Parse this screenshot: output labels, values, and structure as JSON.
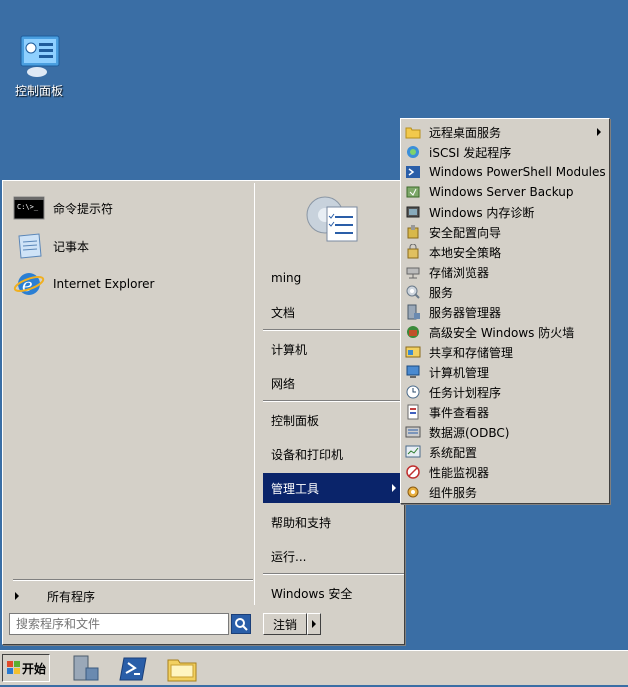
{
  "desktop": {
    "icon_label": "控制面板"
  },
  "start_menu": {
    "programs": [
      {
        "label": "命令提示符",
        "icon": "cmd-icon"
      },
      {
        "label": "记事本",
        "icon": "notepad-icon"
      },
      {
        "label": "Internet Explorer",
        "icon": "ie-icon"
      }
    ],
    "all_programs": "所有程序",
    "search_placeholder": "搜索程序和文件",
    "right": {
      "user": "ming",
      "documents": "文档",
      "computer": "计算机",
      "network": "网络",
      "control_panel": "控制面板",
      "devices": "设备和打印机",
      "admin_tools": "管理工具",
      "help": "帮助和支持",
      "run": "运行...",
      "windows_security": "Windows 安全"
    },
    "logoff": "注销"
  },
  "submenu": {
    "items": [
      {
        "label": "远程桌面服务",
        "icon": "folder-icon",
        "has_submenu": true
      },
      {
        "label": "iSCSI 发起程序",
        "icon": "iscsi-icon"
      },
      {
        "label": "Windows PowerShell Modules",
        "icon": "powershell-icon"
      },
      {
        "label": "Windows Server Backup",
        "icon": "backup-icon"
      },
      {
        "label": "Windows 内存诊断",
        "icon": "memory-diagnostic-icon"
      },
      {
        "label": "安全配置向导",
        "icon": "security-wizard-icon"
      },
      {
        "label": "本地安全策略",
        "icon": "security-policy-icon"
      },
      {
        "label": "存储浏览器",
        "icon": "storage-explorer-icon"
      },
      {
        "label": "服务",
        "icon": "services-icon"
      },
      {
        "label": "服务器管理器",
        "icon": "server-manager-icon"
      },
      {
        "label": "高级安全 Windows 防火墙",
        "icon": "firewall-icon"
      },
      {
        "label": "共享和存储管理",
        "icon": "share-storage-icon"
      },
      {
        "label": "计算机管理",
        "icon": "computer-management-icon"
      },
      {
        "label": "任务计划程序",
        "icon": "task-scheduler-icon"
      },
      {
        "label": "事件查看器",
        "icon": "event-viewer-icon"
      },
      {
        "label": "数据源(ODBC)",
        "icon": "odbc-icon"
      },
      {
        "label": "系统配置",
        "icon": "system-config-icon"
      },
      {
        "label": "性能监视器",
        "icon": "performance-monitor-icon"
      },
      {
        "label": "组件服务",
        "icon": "component-services-icon"
      }
    ]
  },
  "taskbar": {
    "start_label": "开始",
    "pinned": [
      "server-manager-icon",
      "powershell-icon",
      "explorer-icon"
    ]
  }
}
